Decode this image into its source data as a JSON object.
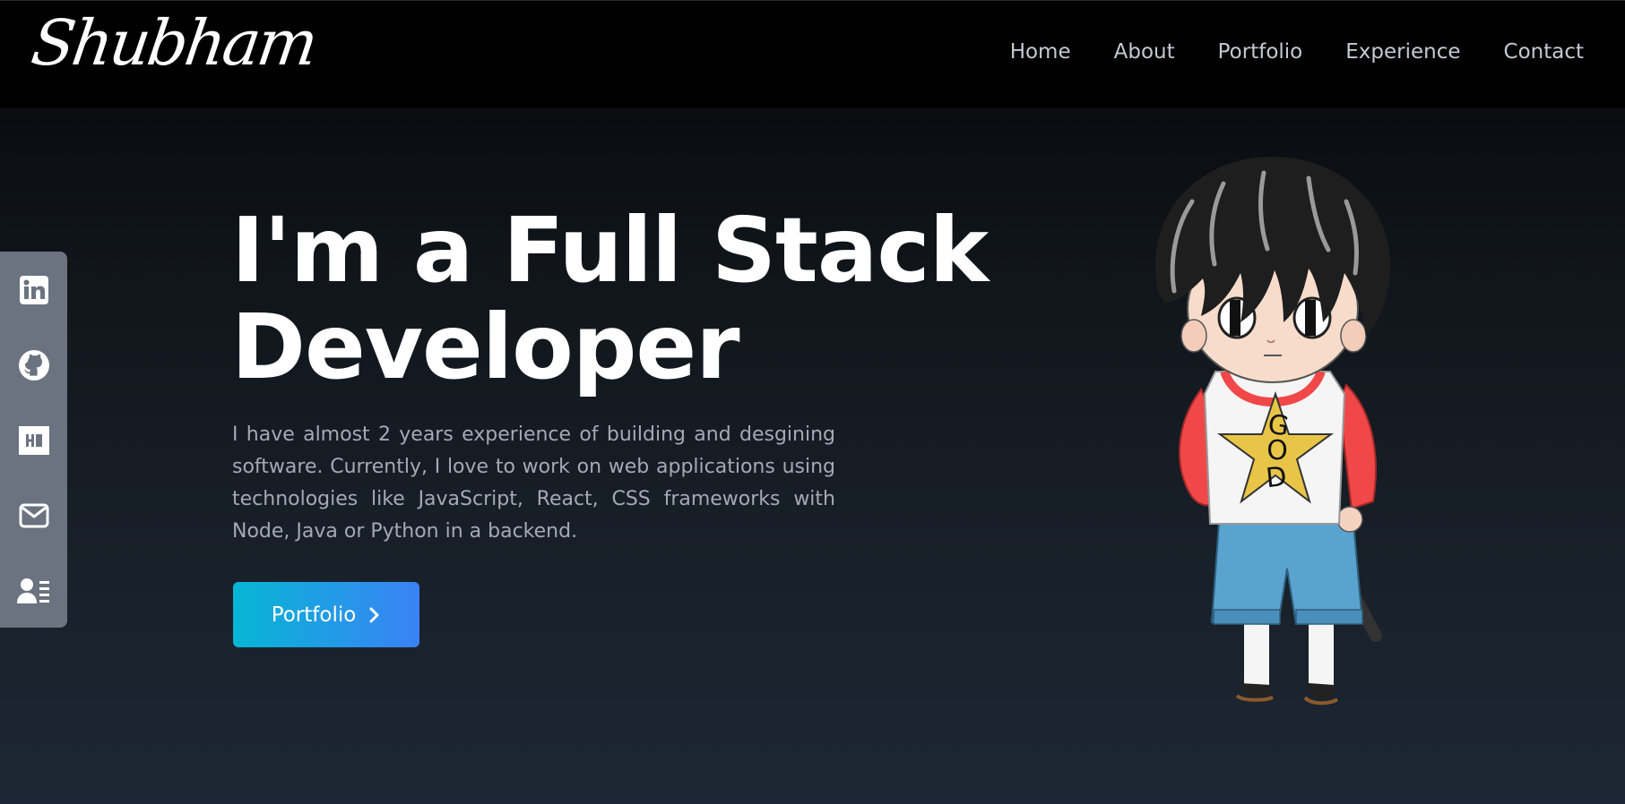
{
  "header": {
    "logo": "Shubham",
    "nav": [
      "Home",
      "About",
      "Portfolio",
      "Experience",
      "Contact"
    ]
  },
  "social": {
    "icons": [
      "linkedin-icon",
      "github-icon",
      "hackerrank-icon",
      "mail-icon",
      "resume-icon"
    ]
  },
  "hero": {
    "title_line1": "I'm a Full Stack",
    "title_line2": "Developer",
    "description": "I have almost 2 years experience of building and desgining software. Currently, I love to work on web applications using technologies like JavaScript, React, CSS frameworks with Node, Java or Python in a backend.",
    "button_label": "Portfolio",
    "shirt_text": "GOD"
  },
  "colors": {
    "button_start": "#06b6d4",
    "button_end": "#3b82f6",
    "social_bg": "#6b7280",
    "nav_text": "#c4c9d2"
  }
}
